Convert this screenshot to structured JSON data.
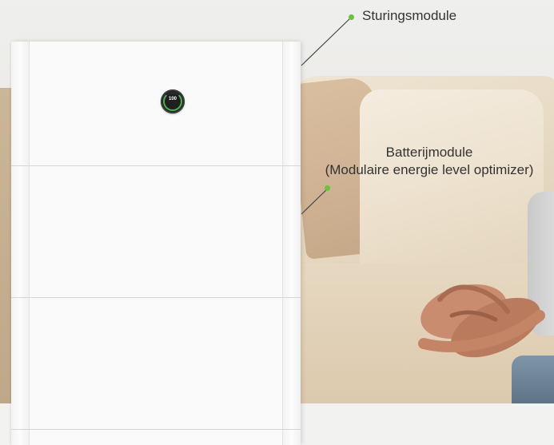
{
  "display": {
    "value": "100"
  },
  "callouts": {
    "control_module": "Sturingsmodule",
    "battery_module_line1": "Batterijmodule",
    "battery_module_line2": "(Modulaire energie level optimizer)"
  },
  "colors": {
    "accent_dot": "#6cc23a",
    "cabinet": "#fafafa",
    "label_text": "#333333"
  }
}
